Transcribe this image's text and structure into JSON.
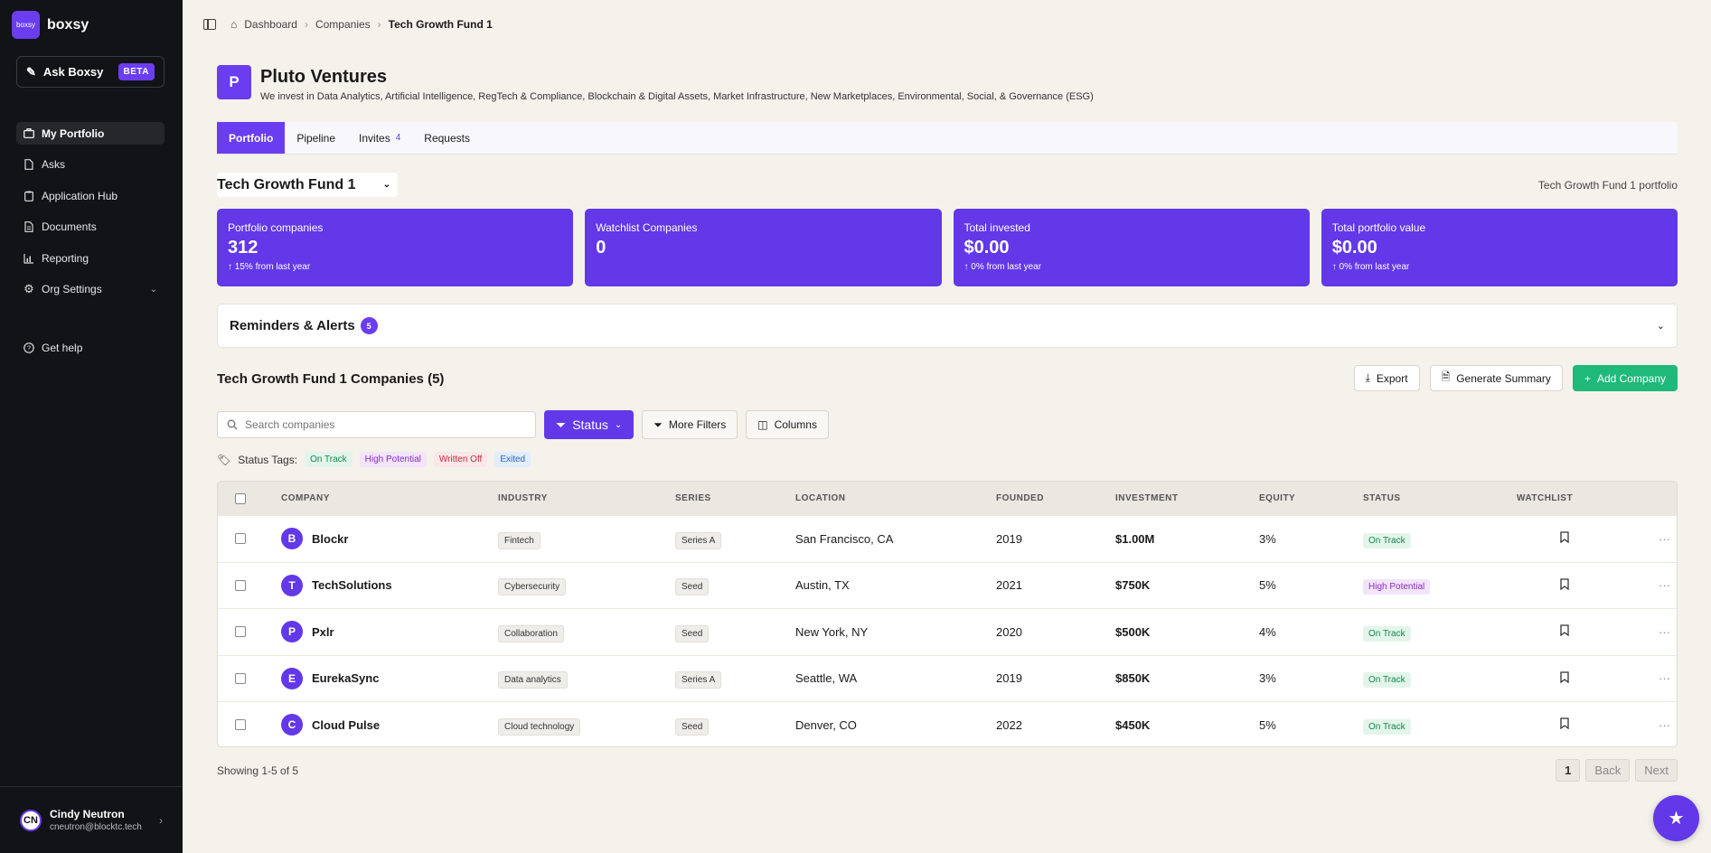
{
  "brand": {
    "logo_text": "boxsy",
    "name": "boxsy"
  },
  "ask": {
    "label": "Ask Boxsy",
    "badge": "BETA"
  },
  "sidebar": {
    "items": [
      {
        "label": "My Portfolio",
        "icon": "briefcase-icon",
        "active": true
      },
      {
        "label": "Asks",
        "icon": "file-icon"
      },
      {
        "label": "Application Hub",
        "icon": "clipboard-icon"
      },
      {
        "label": "Documents",
        "icon": "document-icon"
      },
      {
        "label": "Reporting",
        "icon": "chart-icon"
      },
      {
        "label": "Org Settings",
        "icon": "gear-icon"
      }
    ],
    "help": "Get help"
  },
  "user": {
    "initials": "CN",
    "name": "Cindy Neutron",
    "email": "cneutron@blocktc.tech"
  },
  "breadcrumb": {
    "home": "Dashboard",
    "mid": "Companies",
    "current": "Tech Growth Fund 1"
  },
  "org": {
    "logo_letter": "P",
    "name": "Pluto Ventures",
    "description": "We invest in Data Analytics, Artificial Intelligence, RegTech & Compliance, Blockchain & Digital Assets, Market Infrastructure, New Marketplaces, Environmental, Social, & Governance (ESG)"
  },
  "tabs": {
    "portfolio": "Portfolio",
    "pipeline": "Pipeline",
    "invites": "Invites",
    "invites_count": "4",
    "requests": "Requests"
  },
  "fund": {
    "selected": "Tech Growth Fund 1",
    "right_label": "Tech Growth Fund 1 portfolio"
  },
  "stats": [
    {
      "label": "Portfolio companies",
      "value": "312",
      "change": "15% from last year"
    },
    {
      "label": "Watchlist Companies",
      "value": "0",
      "change": ""
    },
    {
      "label": "Total invested",
      "value": "$0.00",
      "change": "0% from last year"
    },
    {
      "label": "Total portfolio value",
      "value": "$0.00",
      "change": "0% from last year"
    }
  ],
  "reminders": {
    "title": "Reminders & Alerts",
    "count": "5"
  },
  "companies": {
    "title": "Tech Growth Fund 1 Companies (5)",
    "export": "Export",
    "summary": "Generate Summary",
    "add": "Add Company"
  },
  "filters": {
    "search_placeholder": "Search companies",
    "status": "Status",
    "more": "More Filters",
    "columns": "Columns"
  },
  "tags": {
    "label": "Status Tags:",
    "items": [
      "On Track",
      "High Potential",
      "Written Off",
      "Exited"
    ]
  },
  "table": {
    "headers": [
      "COMPANY",
      "INDUSTRY",
      "SERIES",
      "LOCATION",
      "FOUNDED",
      "INVESTMENT",
      "EQUITY",
      "STATUS",
      "WATCHLIST"
    ],
    "rows": [
      {
        "initial": "B",
        "name": "Blockr",
        "industry": "Fintech",
        "series": "Series A",
        "location": "San Francisco, CA",
        "founded": "2019",
        "investment": "$1.00M",
        "equity": "3%",
        "status": "On Track"
      },
      {
        "initial": "T",
        "name": "TechSolutions",
        "industry": "Cybersecurity",
        "series": "Seed",
        "location": "Austin, TX",
        "founded": "2021",
        "investment": "$750K",
        "equity": "5%",
        "status": "High Potential"
      },
      {
        "initial": "P",
        "name": "Pxlr",
        "industry": "Collaboration",
        "series": "Seed",
        "location": "New York, NY",
        "founded": "2020",
        "investment": "$500K",
        "equity": "4%",
        "status": "On Track"
      },
      {
        "initial": "E",
        "name": "EurekaSync",
        "industry": "Data analytics",
        "series": "Series A",
        "location": "Seattle, WA",
        "founded": "2019",
        "investment": "$850K",
        "equity": "3%",
        "status": "On Track"
      },
      {
        "initial": "C",
        "name": "Cloud Pulse",
        "industry": "Cloud technology",
        "series": "Seed",
        "location": "Denver, CO",
        "founded": "2022",
        "investment": "$450K",
        "equity": "5%",
        "status": "On Track"
      }
    ]
  },
  "pagination": {
    "showing": "Showing 1-5 of 5",
    "page": "1",
    "back": "Back",
    "next": "Next"
  },
  "colors": {
    "accent": "#6238e8",
    "success": "#1fb97a",
    "sidebar": "#121316"
  }
}
